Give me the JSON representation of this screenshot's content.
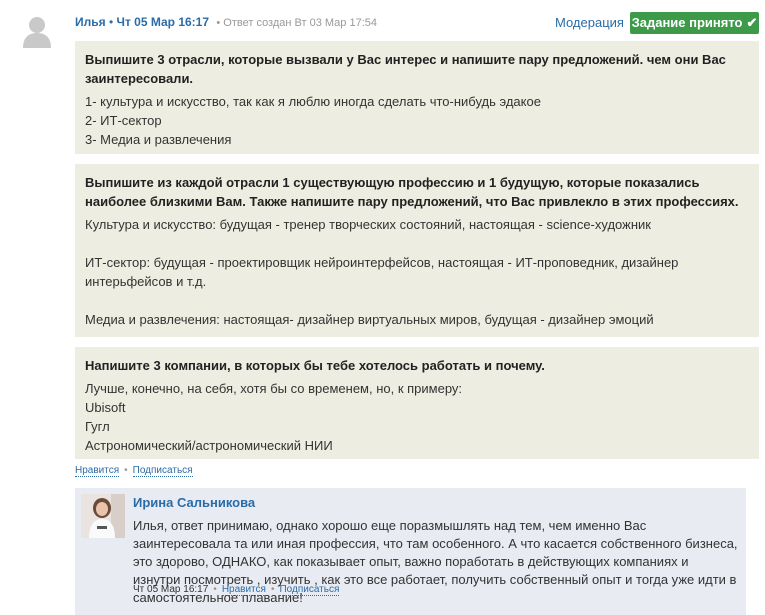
{
  "comment": {
    "author": "Илья",
    "separator": "•",
    "date": "Чт 05 Мар 16:17",
    "created": "• Ответ создан Вт 03 Мар 17:54",
    "moderation_label": "Модерация",
    "accepted_label": "Задание принято",
    "accepted_icon": "check-icon"
  },
  "answers": [
    {
      "question": "Выпишите 3 отрасли, которые вызвали у Вас интерес и напишите пару предложений. чем они Вас заинтересовали.",
      "lines": [
        "1- культура и искусство, так как я люблю иногда сделать что-нибудь эдакое",
        "2- ИТ-сектор",
        "3- Медиа и развлечения"
      ]
    },
    {
      "question": "Выпишите из каждой отрасли 1 существующую профессию и 1 будущую, которые показались наиболее близкими Вам. Также напишите пару предложений, что Вас привлекло в этих профессиях.",
      "lines": [
        "Культура и искусство: будущая - тренер творческих состояний, настоящая - science-художник",
        "ИТ-сектор: будущая - проектировщик нейроинтерфейсов, настоящая - ИТ-проповедник, дизайнер интерьфейсов и т.д.",
        "Медиа и развлечения: настоящая- дизайнер виртуальных миров, будущая - дизайнер эмоций"
      ]
    },
    {
      "question": "Напишите 3 компании, в которых бы тебе хотелось работать и почему.",
      "lines": [
        "Лучше, конечно, на себя, хотя бы со временем, но, к примеру:",
        "Ubisoft",
        "Гугл",
        "Астрономический/астрономический НИИ"
      ]
    }
  ],
  "actions": {
    "like": "Нравится",
    "dot": "•",
    "subscribe": "Подписаться"
  },
  "reply": {
    "author": "Ирина Сальникова",
    "text": "Илья, ответ принимаю, однако хорошо еще поразмышлять над тем, чем именно Вас заинтересовала та или иная профессия, что там особенного. А что касается собственного бизнеса, это здорово, ОДНАКО, как показывает опыт, важно поработать в действующих компаниях и изнутри посмотреть , изучить , как это все работает, получить собственный опыт и тогда уже идти в самостоятельное плавание!",
    "date": "Чт 05 Мар 16:17",
    "dot": "•",
    "like": "Нравится",
    "subscribe": "Подписаться"
  },
  "colors": {
    "link": "#2a6ca8",
    "panel": "#edeee1",
    "accepted": "#3d9a48",
    "reply_bg": "#e8ebf2"
  }
}
